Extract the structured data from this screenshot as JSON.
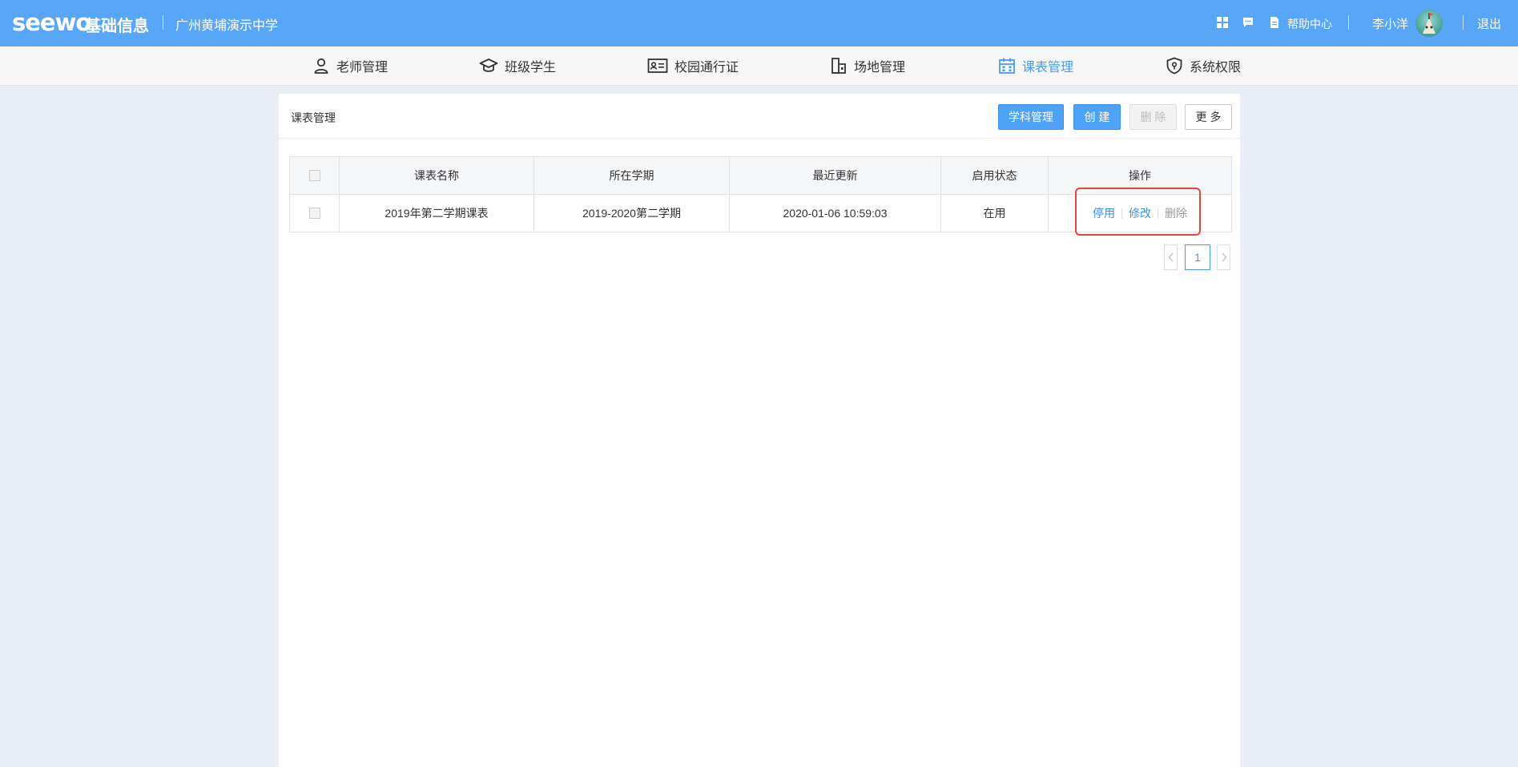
{
  "header": {
    "logo": "seewo",
    "app_name": "基础信息",
    "school": "广州黄埔演示中学",
    "help": "帮助中心",
    "user": "李小洋",
    "logout": "退出"
  },
  "nav": {
    "items": [
      {
        "label": "老师管理",
        "icon": "user-icon"
      },
      {
        "label": "班级学生",
        "icon": "graduation-cap-icon"
      },
      {
        "label": "校园通行证",
        "icon": "id-card-icon"
      },
      {
        "label": "场地管理",
        "icon": "building-icon"
      },
      {
        "label": "课表管理",
        "icon": "calendar-icon",
        "active": true
      },
      {
        "label": "系统权限",
        "icon": "shield-icon"
      }
    ]
  },
  "panel": {
    "title": "课表管理",
    "buttons": {
      "subjects": "学科管理",
      "create": "创 建",
      "delete": "删 除",
      "more": "更 多"
    }
  },
  "table": {
    "headers": [
      "课表名称",
      "所在学期",
      "最近更新",
      "启用状态",
      "操作"
    ],
    "rows": [
      {
        "name": "2019年第二学期课表",
        "term": "2019-2020第二学期",
        "updated": "2020-01-06 10:59:03",
        "status": "在用",
        "actions": [
          "停用",
          "修改",
          "删除"
        ]
      }
    ]
  },
  "pager": {
    "current": "1"
  },
  "colors": {
    "header_bg": "#58a6f7",
    "accent": "#4a9bf0",
    "highlight": "#e2463a"
  }
}
